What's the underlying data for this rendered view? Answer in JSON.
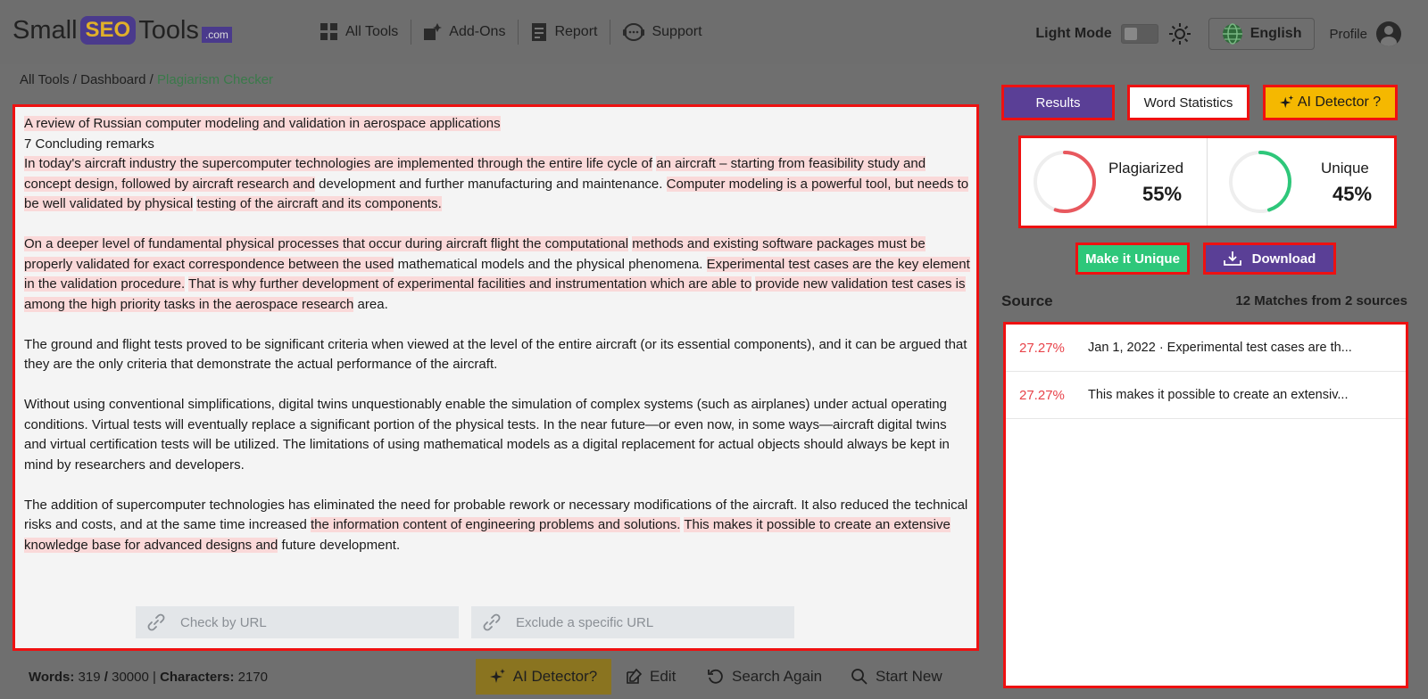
{
  "header": {
    "logo": {
      "small": "Small",
      "seo": "SEO",
      "tools": "Tools",
      "com": ".com"
    },
    "nav": [
      {
        "label": "All Tools",
        "icon": "grid-icon"
      },
      {
        "label": "Add-Ons",
        "icon": "addon-icon"
      },
      {
        "label": "Report",
        "icon": "report-icon"
      },
      {
        "label": "Support",
        "icon": "support-icon"
      }
    ],
    "light_mode_label": "Light Mode",
    "language": "English",
    "profile_label": "Profile"
  },
  "breadcrumb": {
    "all_tools": "All Tools",
    "sep": " / ",
    "dashboard": "Dashboard",
    "current": "Plagiarism Checker"
  },
  "editor": {
    "url_placeholder": "Check by URL",
    "exclude_placeholder": "Exclude a specific URL",
    "p1a": "A review of Russian computer modeling and validation in aerospace applications",
    "p1b": "7 Concluding remarks",
    "p1c_1": "In today's aircraft industry the supercomputer technologies are implemented through the entire life cycle of",
    "p1c_2": "an aircraft – starting from feasibility study and concept design, followed by aircraft research and",
    "p1c_3": " development and further manufacturing and maintenance. ",
    "p1c_4": "Computer modeling is a powerful tool, but needs to be well validated by physical",
    "p1c_5": "testing of the aircraft and its components.",
    "p2_1": "On a deeper level of fundamental physical processes that occur during aircraft flight the computational",
    "p2_2": "methods and existing software packages must be properly validated for exact correspondence between the used",
    "p2_3": " mathematical models and the physical phenomena. ",
    "p2_4": "Experimental test cases are the key element in the validation procedure.",
    "p2_5": "That is why further development of experimental facilities and instrumentation which are able to",
    "p2_6": "provide new validation test cases is among the high priority tasks in the aerospace research",
    "p2_7": " area.",
    "p3": "The ground and flight tests proved to be significant criteria when viewed at the level of the entire aircraft (or its essential components), and it can be argued that they are the only criteria that demonstrate the actual performance of the aircraft.",
    "p4": "Without using conventional simplifications, digital twins unquestionably enable the simulation of complex systems (such as airplanes) under actual operating conditions. Virtual tests will eventually replace a significant portion of the physical tests. In the near future—or even now, in some ways—aircraft digital twins and virtual certification tests will be utilized. The limitations of using mathematical models as a digital replacement for actual objects should always be kept in mind by researchers and developers.",
    "p5_1": "The addition of supercomputer technologies has eliminated the need for probable rework or necessary modifications of the aircraft. It also reduced the technical risks and costs, and at the same time increased ",
    "p5_2": "the information content of engineering problems and solutions.",
    "p5_3": "This makes it possible to create an extensive knowledge base for advanced designs and",
    "p5_4": " future development."
  },
  "bottom": {
    "words_label": "Words:",
    "words_value": " 319 ",
    "slash": "/",
    "words_max": " 30000 | ",
    "chars_label": "Characters:",
    "chars_value": " 2170",
    "ai_detector": "AI Detector?",
    "edit": "Edit",
    "search_again": "Search Again",
    "start_new": "Start New"
  },
  "tabs": {
    "results": "Results",
    "word_statistics": "Word Statistics",
    "ai_detector": "AI Detector ?"
  },
  "scores": {
    "plagiarized_label": "Plagiarized",
    "plagiarized_value": "55%",
    "plagiarized_fraction": 0.55,
    "unique_label": "Unique",
    "unique_value": "45%",
    "unique_fraction": 0.45,
    "plag_color": "#e8585e",
    "unique_color": "#2ec77a"
  },
  "actions": {
    "make_unique": "Make it Unique",
    "download": "Download"
  },
  "sources": {
    "title": "Source",
    "count": "12 Matches from 2 sources",
    "items": [
      {
        "pct": "27.27%",
        "text": "Jan 1, 2022 · Experimental test cases are th..."
      },
      {
        "pct": "27.27%",
        "text": "This makes it possible to create an extensiv..."
      }
    ]
  },
  "colors": {
    "accent_purple": "#5a3f96",
    "accent_yellow": "#f5b800",
    "highlight": "#fad9d9",
    "border_red": "#ee1111"
  }
}
